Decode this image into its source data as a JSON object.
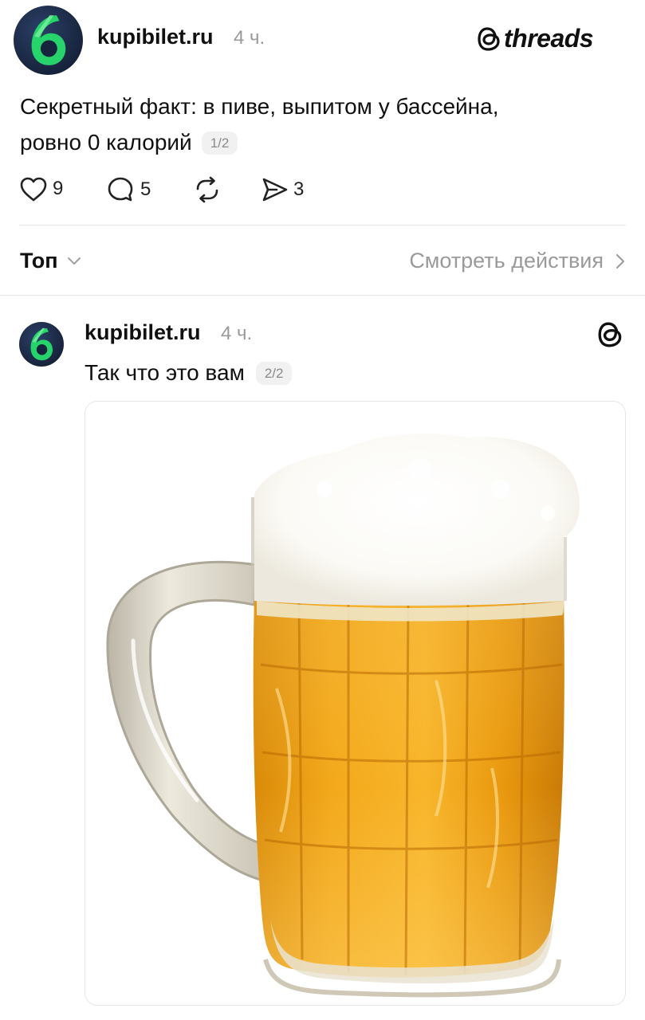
{
  "post1": {
    "username": "kupibilet.ru",
    "time": "4 ч.",
    "platform_label": "threads",
    "text_line1": "Секретный факт: в пиве, выпитом у бассейна,",
    "text_line2": "ровно 0 калорий",
    "counter": "1/2",
    "actions": {
      "likes": "9",
      "comments": "5",
      "reposts": "",
      "shares": "3"
    }
  },
  "sort_bar": {
    "sort_label": "Топ",
    "activity_label": "Смотреть действия"
  },
  "post2": {
    "username": "kupibilet.ru",
    "time": "4 ч.",
    "text": "Так что это вам",
    "counter": "2/2",
    "image_subject": "beer mug"
  },
  "colors": {
    "text": "#101010",
    "muted": "#9a9a9a",
    "divider": "#e7e7e7",
    "avatar_bg": "#17243d",
    "avatar_accent": "#27d36b"
  }
}
